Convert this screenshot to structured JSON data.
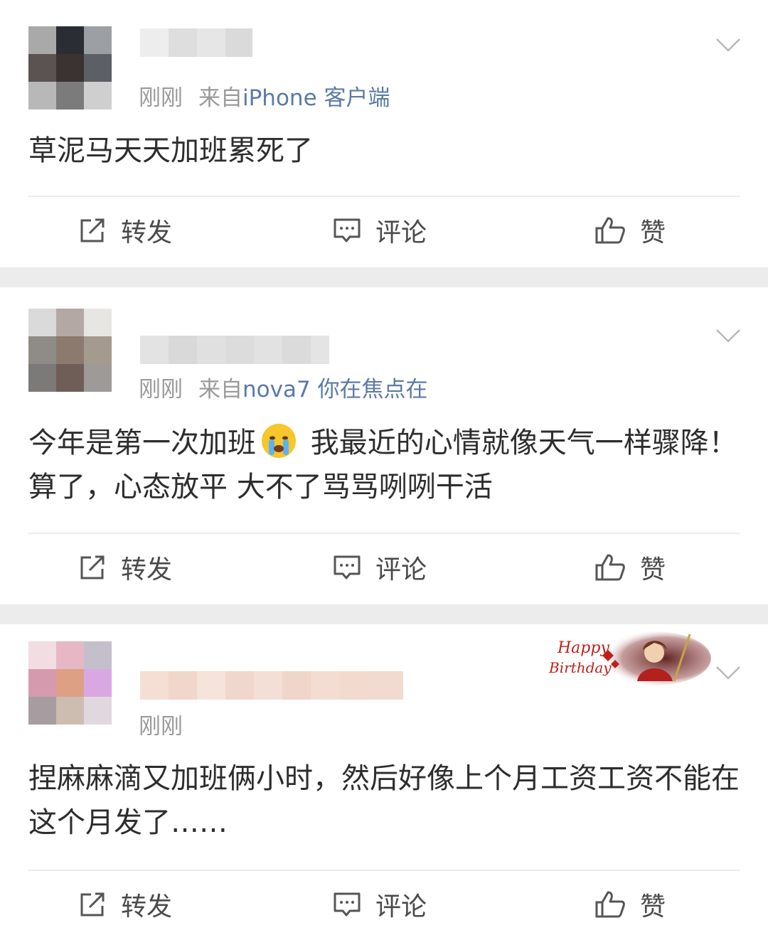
{
  "colors": {
    "source_link": "#5b7aa6",
    "meta_gray": "#9a9a9a",
    "text": "#2d2d2d",
    "separator": "#ececec"
  },
  "actions": {
    "forward": "转发",
    "comment": "评论",
    "like": "赞"
  },
  "posts": [
    {
      "time": "刚刚",
      "from_prefix": "来自",
      "source": "iPhone 客户端",
      "text": "草泥马天天加班累死了",
      "more_icon": "chevron-down-icon"
    },
    {
      "time": "刚刚",
      "from_prefix": "来自",
      "source": "nova7 你在焦点在",
      "text_before_emoji": "今年是第一次加班",
      "emoji": "loudly-crying-face",
      "text_after_emoji": " 我最近的心情就像天气一样骤降！算了，心态放平 大不了骂骂咧咧干活",
      "more_icon": "chevron-down-icon"
    },
    {
      "time": "刚刚",
      "badge": "Happy Birthday",
      "text": "捏麻麻滴又加班俩小时，然后好像上个月工资工资不能在这个月发了……",
      "more_icon": "chevron-down-icon"
    }
  ]
}
